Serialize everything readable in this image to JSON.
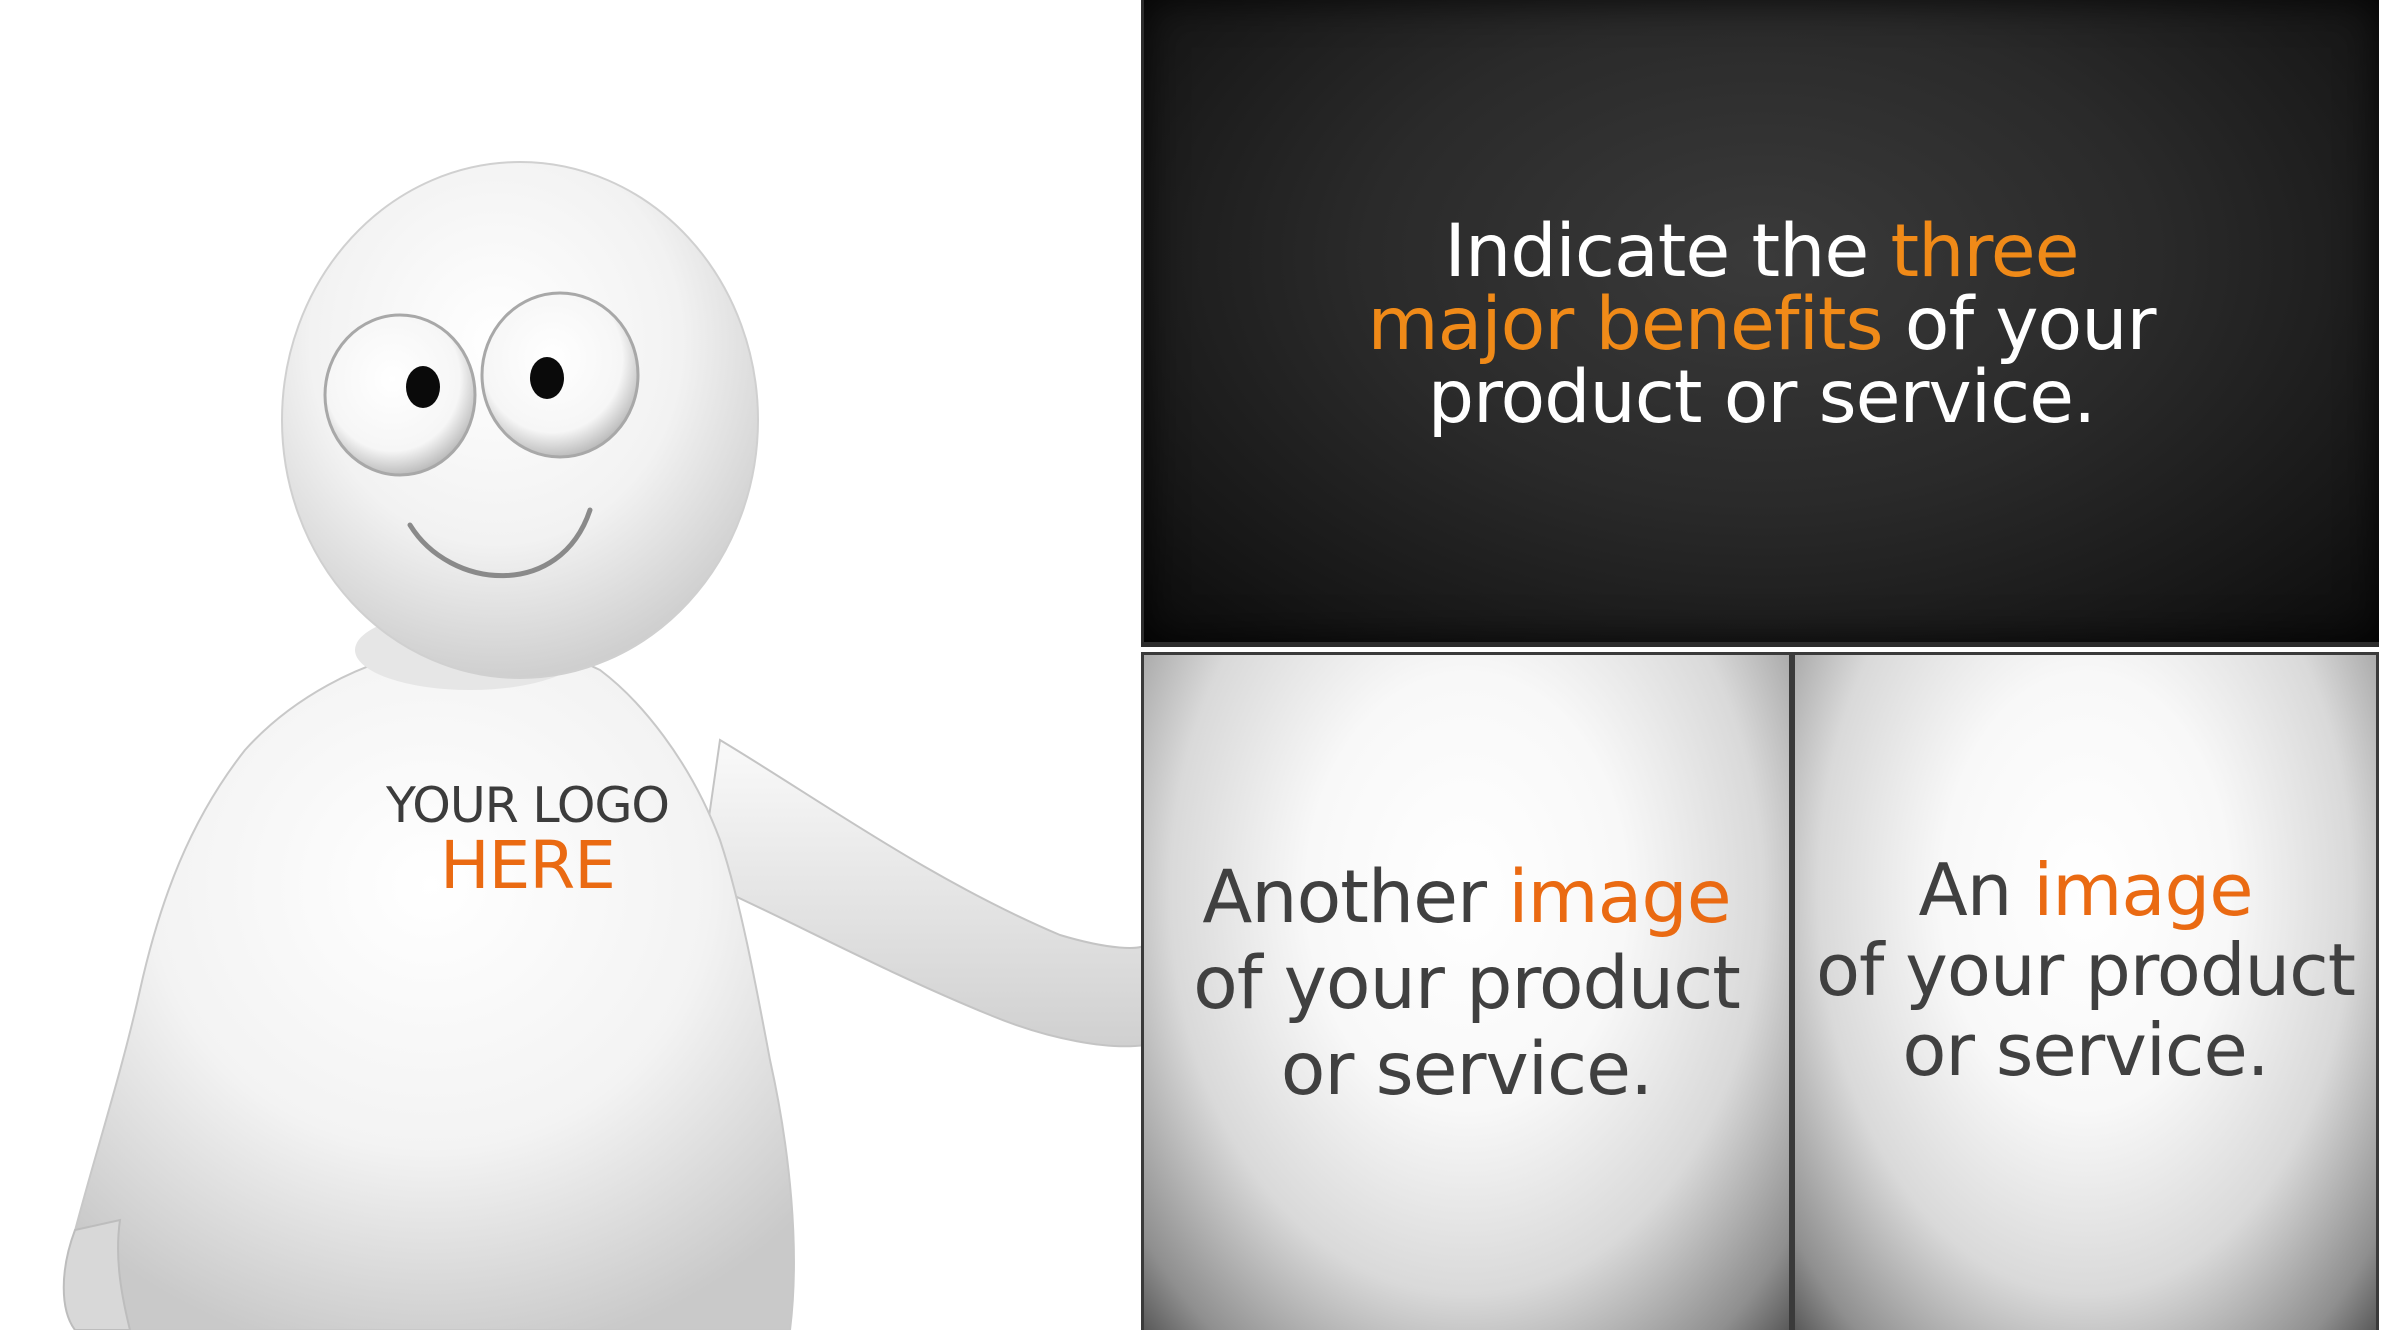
{
  "character": {
    "logo_line1": "YOUR LOGO",
    "logo_line2": "HERE"
  },
  "benefits": {
    "line1_pre": "Indicate  the ",
    "line1_accent": "three",
    "line2_accent": "major benefits",
    "line2_post": " of your",
    "line3": "product or service."
  },
  "panel_left": {
    "pre": "Another ",
    "accent": "image",
    "line2": "of your product",
    "line3": "or service."
  },
  "panel_right": {
    "pre": "An ",
    "accent": "image",
    "line2": "of your product",
    "line3": "or service."
  },
  "colors": {
    "accent_orange": "#f08a18",
    "accent_red_orange": "#ea6a12",
    "dark_panel": "#2a2a2a",
    "text_gray": "#404040"
  }
}
